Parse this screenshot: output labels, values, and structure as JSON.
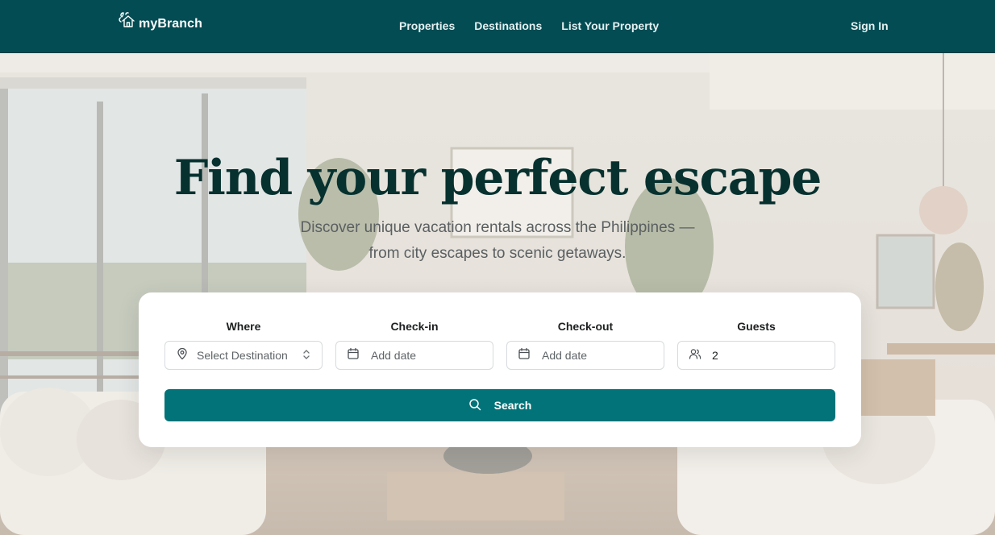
{
  "brand": {
    "name": "myBranch"
  },
  "nav": {
    "items": [
      {
        "label": "Properties"
      },
      {
        "label": "Destinations"
      },
      {
        "label": "List Your Property"
      }
    ],
    "sign_in": "Sign In"
  },
  "hero": {
    "headline": "Find your perfect escape",
    "subline": "Discover unique vacation rentals across the Philippines — from city escapes to scenic getaways."
  },
  "search": {
    "where": {
      "label": "Where",
      "placeholder": "Select Destination",
      "icon": "map-pin-icon"
    },
    "check_in": {
      "label": "Check-in",
      "placeholder": "Add date",
      "icon": "calendar-icon"
    },
    "check_out": {
      "label": "Check-out",
      "placeholder": "Add date",
      "icon": "calendar-icon"
    },
    "guests": {
      "label": "Guests",
      "value": "2",
      "icon": "users-icon"
    },
    "button_label": "Search"
  },
  "colors": {
    "header_bg": "#034c53",
    "button_bg": "#027378",
    "headline": "#06312f"
  }
}
